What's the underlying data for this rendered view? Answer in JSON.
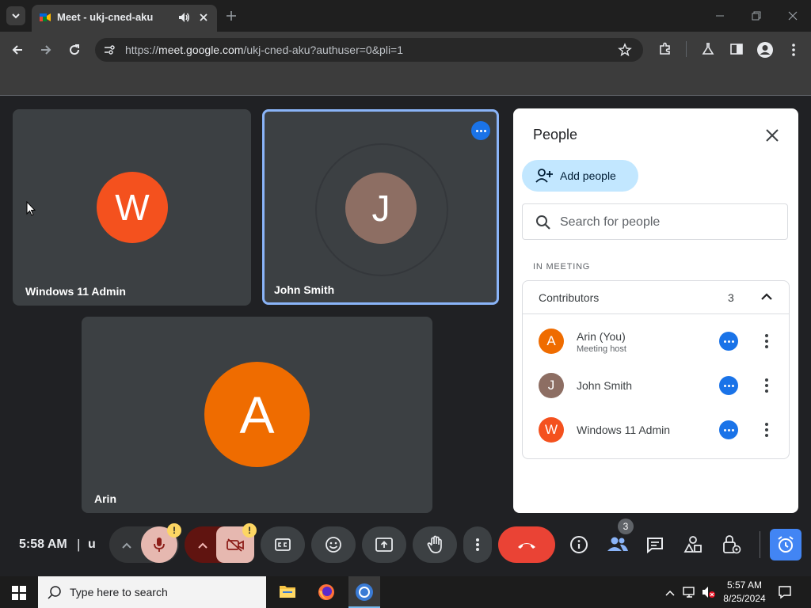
{
  "browser": {
    "tab_title": "Meet - ukj-cned-aku",
    "url_prefix": "https://",
    "url_domain": "meet.google.com",
    "url_path": "/ukj-cned-aku?authuser=0&pli=1"
  },
  "tiles": [
    {
      "name": "Windows 11 Admin",
      "initial": "W",
      "color": "#f4511e"
    },
    {
      "name": "John Smith",
      "initial": "J",
      "color": "#8d6e63"
    },
    {
      "name": "Arin",
      "initial": "A",
      "color": "#ef6c00"
    }
  ],
  "panel": {
    "title": "People",
    "add_people": "Add people",
    "search_placeholder": "Search for people",
    "section_label": "IN MEETING",
    "group_label": "Contributors",
    "group_count": "3",
    "people": [
      {
        "name": "Arin (You)",
        "sub": "Meeting host",
        "initial": "A",
        "color": "#ef6c00"
      },
      {
        "name": "John Smith",
        "sub": "",
        "initial": "J",
        "color": "#8d6e63"
      },
      {
        "name": "Windows 11 Admin",
        "sub": "",
        "initial": "W",
        "color": "#f4511e"
      }
    ]
  },
  "controls": {
    "time": "5:58 AM",
    "separator": "|",
    "meeting_code_fragment": "u",
    "people_badge": "3",
    "warning_mark": "!"
  },
  "taskbar": {
    "search_placeholder": "Type here to search",
    "clock_time": "5:57 AM",
    "clock_date": "8/25/2024"
  },
  "colors": {
    "accent_blue": "#1a73e8",
    "end_call_red": "#ea4335",
    "add_people_bg": "#c2e7ff",
    "active_tile_border": "#8ab4f8"
  }
}
